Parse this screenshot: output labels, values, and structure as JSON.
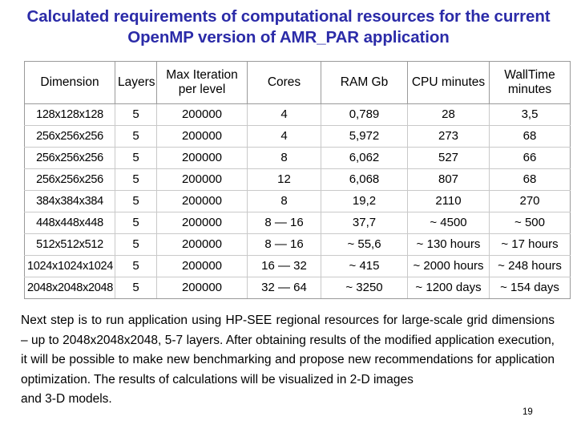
{
  "slide": {
    "title": "Calculated requirements of computational resources for the current OpenMP version of AMR_PAR application",
    "number": "19",
    "title_color": "#2b2ba8",
    "grid_color": "#c9c9c9",
    "border_color": "#9a9a9a"
  },
  "table": {
    "headers": [
      "Dimension",
      "Layers",
      "Max Iteration per level",
      "Cores",
      "RAM Gb",
      "CPU minutes",
      "WallTime minutes"
    ],
    "rows": [
      {
        "dimension": "128x128x128",
        "layers": "5",
        "max_iteration_per_level": "200000",
        "cores": "4",
        "ram_gb": "0,789",
        "cpu_minutes": "28",
        "walltime_minutes": "3,5"
      },
      {
        "dimension": "256x256x256",
        "layers": "5",
        "max_iteration_per_level": "200000",
        "cores": "4",
        "ram_gb": "5,972",
        "cpu_minutes": "273",
        "walltime_minutes": "68"
      },
      {
        "dimension": "256x256x256",
        "layers": "5",
        "max_iteration_per_level": "200000",
        "cores": "8",
        "ram_gb": "6,062",
        "cpu_minutes": "527",
        "walltime_minutes": "66"
      },
      {
        "dimension": "256x256x256",
        "layers": "5",
        "max_iteration_per_level": "200000",
        "cores": "12",
        "ram_gb": "6,068",
        "cpu_minutes": "807",
        "walltime_minutes": "68"
      },
      {
        "dimension": "384x384x384",
        "layers": "5",
        "max_iteration_per_level": "200000",
        "cores": "8",
        "ram_gb": "19,2",
        "cpu_minutes": "2110",
        "walltime_minutes": "270"
      },
      {
        "dimension": "448x448x448",
        "layers": "5",
        "max_iteration_per_level": "200000",
        "cores": "8 — 16",
        "ram_gb": "37,7",
        "cpu_minutes": "~ 4500",
        "walltime_minutes": "~  500"
      },
      {
        "dimension": "512x512x512",
        "layers": "5",
        "max_iteration_per_level": "200000",
        "cores": "8 — 16",
        "ram_gb": "~ 55,6",
        "cpu_minutes": "~ 130 hours",
        "walltime_minutes": "~ 17 hours"
      },
      {
        "dimension": "1024x1024x1024",
        "layers": "5",
        "max_iteration_per_level": "200000",
        "cores": "16 — 32",
        "ram_gb": "~ 415",
        "cpu_minutes": "~ 2000 hours",
        "walltime_minutes": "~ 248 hours"
      },
      {
        "dimension": "2048x2048x2048",
        "layers": "5",
        "max_iteration_per_level": "200000",
        "cores": "32 — 64",
        "ram_gb": "~ 3250",
        "cpu_minutes": "~ 1200 days",
        "walltime_minutes": "~ 154 days"
      }
    ]
  },
  "body": {
    "main": "Next step is to run application using HP-SEE regional resources for large-scale grid dimensions – up to 2048x2048x2048, 5-7 layers. After obtaining results of the modified application execution, it will be possible to make new benchmarking and propose new recommendations for application optimization. The results of calculations will be visualized in 2-D images",
    "last_line": "and 3-D models."
  }
}
